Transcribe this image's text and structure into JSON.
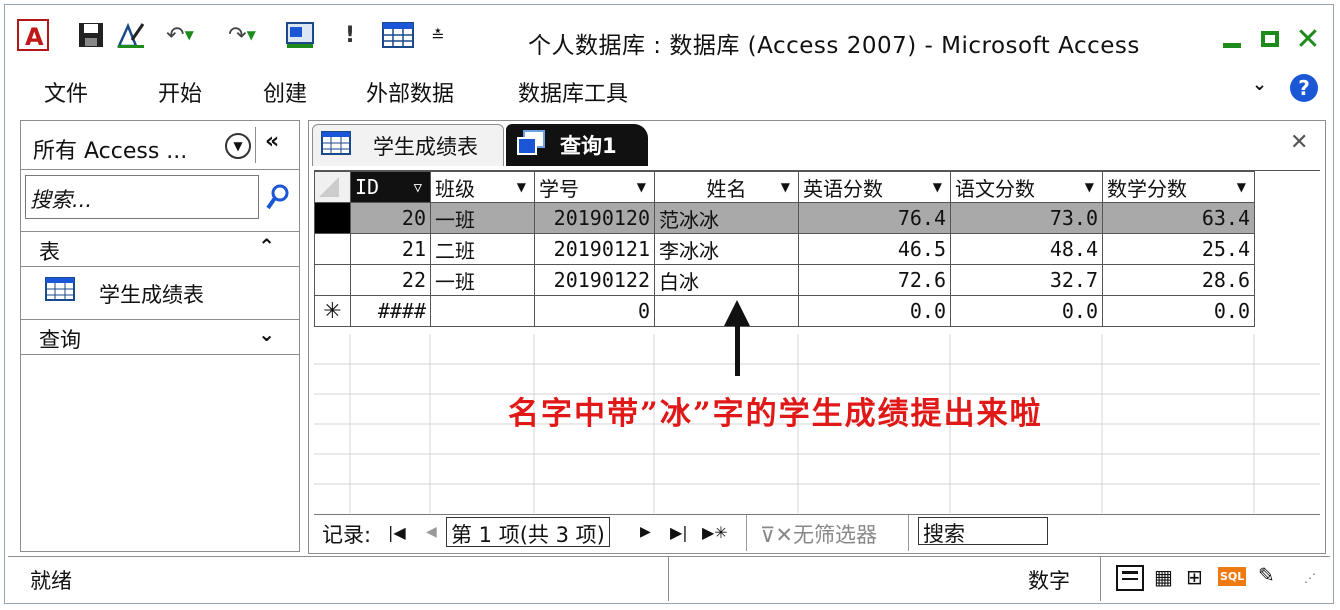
{
  "window": {
    "title": "个人数据库 : 数据库 (Access 2007)  -  Microsoft Access"
  },
  "quick_access": {
    "icons": [
      "access-logo-icon",
      "save-icon",
      "design-icon",
      "undo-icon",
      "redo-icon",
      "view-icon",
      "run-icon",
      "table-icon",
      "customize-icon"
    ]
  },
  "menu": {
    "items": [
      "文件",
      "开始",
      "创建",
      "外部数据",
      "数据库工具"
    ]
  },
  "nav_pane": {
    "title": "所有 Access ...",
    "search_placeholder": "搜索...",
    "section_tables": "表",
    "table_item": "学生成绩表",
    "section_queries": "查询"
  },
  "tabs": {
    "tab1": "学生成绩表",
    "tab2": "查询1"
  },
  "grid": {
    "columns": [
      "ID",
      "班级",
      "学号",
      "姓名",
      "英语分数",
      "语文分数",
      "数学分数"
    ],
    "rows": [
      {
        "id": "20",
        "class": "一班",
        "sid": "20190120",
        "name": "范冰冰",
        "eng": "76.4",
        "chn": "73.0",
        "math": "63.4"
      },
      {
        "id": "21",
        "class": "二班",
        "sid": "20190121",
        "name": "李冰冰",
        "eng": "46.5",
        "chn": "48.4",
        "math": "25.4"
      },
      {
        "id": "22",
        "class": "一班",
        "sid": "20190122",
        "name": "白冰",
        "eng": "72.6",
        "chn": "32.7",
        "math": "28.6"
      }
    ],
    "new_row": {
      "marker": "✳",
      "id": "####",
      "class": "",
      "sid": "0",
      "name": "",
      "eng": "0.0",
      "chn": "0.0",
      "math": "0.0"
    }
  },
  "record_nav": {
    "label": "记录:",
    "position": "第 1 项(共 3 项)",
    "filter": "无筛选器",
    "search": "搜索"
  },
  "annotation": {
    "text": "名字中带”冰”字的学生成绩提出来啦"
  },
  "status": {
    "left": "就绪",
    "numlock": "数字"
  },
  "colors": {
    "accent_green": "#1c8b1c",
    "annotation_red": "#e01818",
    "help_blue": "#1a56d6"
  }
}
